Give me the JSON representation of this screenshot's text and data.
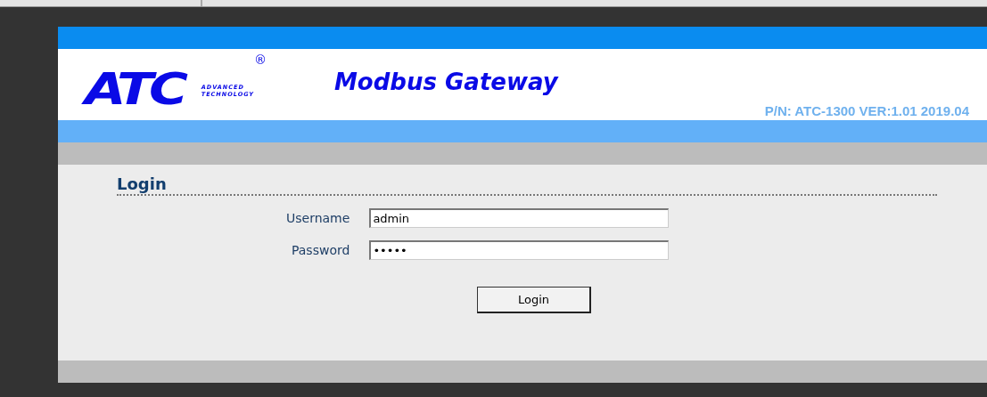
{
  "logo": {
    "letters": "ATC",
    "registered": "®",
    "tagline": [
      "ADVANCED",
      "TECHNOLOGY"
    ]
  },
  "header": {
    "title": "Modbus Gateway",
    "part_number": "P/N: ATC-1300 VER:1.01 2019.04"
  },
  "login": {
    "heading": "Login",
    "fields": [
      {
        "label": "Username",
        "value": "admin"
      },
      {
        "label": "Password",
        "value": "•••••"
      }
    ],
    "button": "Login"
  }
}
